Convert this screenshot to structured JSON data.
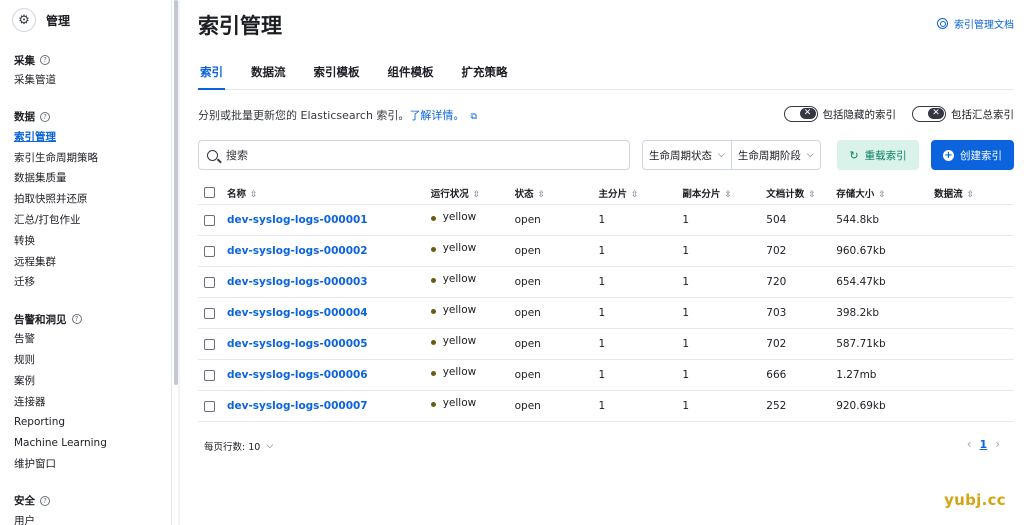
{
  "sidebar": {
    "title": "管理",
    "groups": [
      {
        "title": "采集",
        "items": [
          "采集管道"
        ]
      },
      {
        "title": "数据",
        "items": [
          "索引管理",
          "索引生命周期策略",
          "数据集质量",
          "拍取快照并还原",
          "汇总/打包作业",
          "转换",
          "远程集群",
          "迁移"
        ]
      },
      {
        "title": "告警和洞见",
        "items": [
          "告警",
          "规则",
          "案例",
          "连接器",
          "Reporting",
          "Machine Learning",
          "维护窗口"
        ]
      },
      {
        "title": "安全",
        "items": [
          "用户"
        ]
      }
    ],
    "active_item": "索引管理"
  },
  "header": {
    "title": "索引管理",
    "doc_link": "索引管理文档"
  },
  "tabs": [
    "索引",
    "数据流",
    "索引模板",
    "组件模板",
    "扩充策略"
  ],
  "active_tab": "索引",
  "description": {
    "text": "分别或批量更新您的 Elasticsearch 索引。",
    "link": "了解详情。"
  },
  "toggles": {
    "hidden_label": "包括隐藏的索引",
    "rollup_label": "包括汇总索引"
  },
  "search": {
    "placeholder": "搜索"
  },
  "filters": {
    "lifecycle_status": "生命周期状态",
    "lifecycle_phase": "生命周期阶段"
  },
  "buttons": {
    "reload": "重载索引",
    "create": "创建索引"
  },
  "table": {
    "columns": [
      "名称",
      "运行状况",
      "状态",
      "主分片",
      "副本分片",
      "文档计数",
      "存储大小",
      "数据流"
    ],
    "rows": [
      {
        "name": "dev-syslog-logs-000001",
        "health": "yellow",
        "status": "open",
        "primary": "1",
        "replica": "1",
        "docs": "504",
        "size": "544.8kb"
      },
      {
        "name": "dev-syslog-logs-000002",
        "health": "yellow",
        "status": "open",
        "primary": "1",
        "replica": "1",
        "docs": "702",
        "size": "960.67kb"
      },
      {
        "name": "dev-syslog-logs-000003",
        "health": "yellow",
        "status": "open",
        "primary": "1",
        "replica": "1",
        "docs": "720",
        "size": "654.47kb"
      },
      {
        "name": "dev-syslog-logs-000004",
        "health": "yellow",
        "status": "open",
        "primary": "1",
        "replica": "1",
        "docs": "703",
        "size": "398.2kb"
      },
      {
        "name": "dev-syslog-logs-000005",
        "health": "yellow",
        "status": "open",
        "primary": "1",
        "replica": "1",
        "docs": "702",
        "size": "587.71kb"
      },
      {
        "name": "dev-syslog-logs-000006",
        "health": "yellow",
        "status": "open",
        "primary": "1",
        "replica": "1",
        "docs": "666",
        "size": "1.27mb"
      },
      {
        "name": "dev-syslog-logs-000007",
        "health": "yellow",
        "status": "open",
        "primary": "1",
        "replica": "1",
        "docs": "252",
        "size": "920.69kb"
      }
    ]
  },
  "pagination": {
    "rows_per_page": "每页行数: 10",
    "current_page": "1"
  },
  "watermark": "yubj.cc",
  "colors": {
    "accent": "#0b64dd",
    "health_yellow": "#6a5b13",
    "reload_bg": "#d9f2ea"
  }
}
